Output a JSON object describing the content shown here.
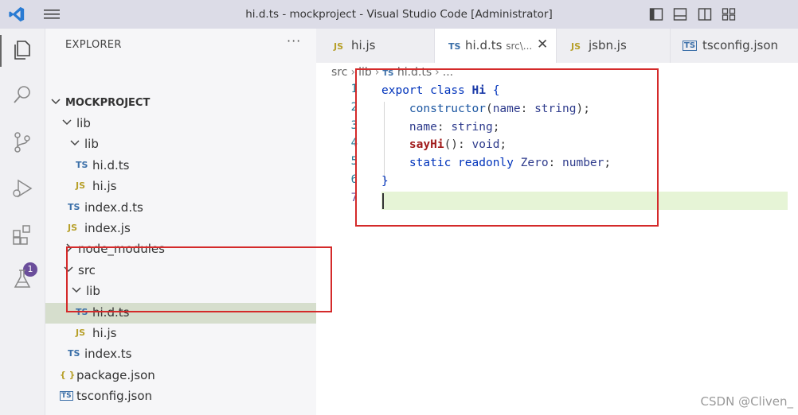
{
  "window": {
    "title": "hi.d.ts - mockproject - Visual Studio Code [Administrator]",
    "icons": [
      "vscode-logo-icon",
      "hamburger-menu-icon",
      "toggle-primary-sidebar-icon",
      "toggle-panel-icon",
      "toggle-secondary-sidebar-icon",
      "customize-layout-icon"
    ]
  },
  "activity_bar": {
    "items": [
      "explorer-icon",
      "search-icon",
      "source-control-icon",
      "run-debug-icon",
      "extensions-icon",
      "testing-icon"
    ],
    "extensions_badge": "1"
  },
  "explorer": {
    "header": "EXPLORER",
    "more": "···",
    "project": "MOCKPROJECT",
    "tree": [
      {
        "label": "lib",
        "kind": "folder"
      },
      {
        "label": "lib",
        "kind": "folder"
      },
      {
        "label": "hi.d.ts",
        "kind": "ts",
        "icon": "TS"
      },
      {
        "label": "hi.js",
        "kind": "js",
        "icon": "JS"
      },
      {
        "label": "index.d.ts",
        "kind": "ts",
        "icon": "TS"
      },
      {
        "label": "index.js",
        "kind": "js",
        "icon": "JS"
      },
      {
        "label": "node_modules",
        "kind": "folder"
      },
      {
        "label": "src",
        "kind": "folder"
      },
      {
        "label": "lib",
        "kind": "folder"
      },
      {
        "label": "hi.d.ts",
        "kind": "ts",
        "icon": "TS"
      },
      {
        "label": "hi.js",
        "kind": "js",
        "icon": "JS"
      },
      {
        "label": "index.ts",
        "kind": "ts",
        "icon": "TS"
      },
      {
        "label": "package.json",
        "kind": "json",
        "icon": "{ }"
      },
      {
        "label": "tsconfig.json",
        "kind": "tsconfig",
        "icon": "TS"
      }
    ]
  },
  "tabs": [
    {
      "icon": "JS",
      "label": "hi.js",
      "desc": ""
    },
    {
      "icon": "TS",
      "label": "hi.d.ts",
      "desc": "src\\...",
      "close": "✕"
    },
    {
      "icon": "JS",
      "label": "jsbn.js",
      "desc": ""
    },
    {
      "icon": "TS",
      "label": "tsconfig.json",
      "desc": ""
    }
  ],
  "breadcrumb": {
    "parts": [
      "src",
      "lib"
    ],
    "file_icon": "TS",
    "file": "hi.d.ts",
    "tail": "..."
  },
  "code": {
    "line_numbers": [
      "1",
      "2",
      "3",
      "4",
      "5",
      "6",
      "7"
    ],
    "tokens": {
      "l1_kw1": "export",
      "l1_kw2": "class",
      "l1_cls": "Hi",
      "l1_brace": "{",
      "l2_fn": "constructor",
      "l2_open": "(",
      "l2_param": "name",
      "l2_colon": ": ",
      "l2_type": "string",
      "l2_close": ");",
      "l3_prop": "name",
      "l3_colon": ": ",
      "l3_type": "string",
      "l3_semi": ";",
      "l4_meth": "sayHi",
      "l4_paren": "(): ",
      "l4_type": "void",
      "l4_semi": ";",
      "l5_kw1": "static",
      "l5_kw2": "readonly",
      "l5_prop": "Zero",
      "l5_colon": ": ",
      "l5_type": "number",
      "l5_semi": ";",
      "l6_brace": "}"
    }
  },
  "watermark": "CSDN @Cliven_",
  "colors": {
    "annotation_red": "#d42a2a",
    "selection_green": "#d6decd",
    "current_line": "#e6f4d6"
  }
}
